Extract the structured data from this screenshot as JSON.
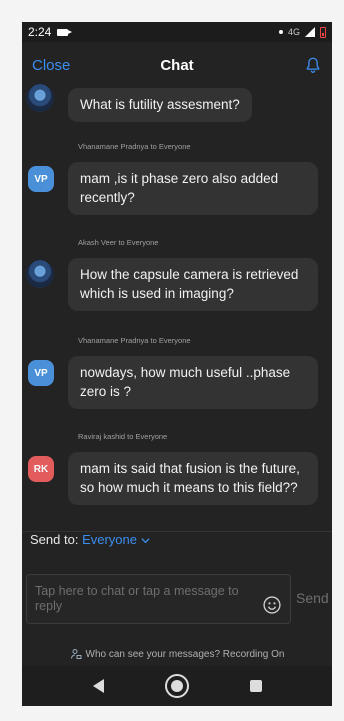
{
  "statusbar": {
    "time": "2:24",
    "network": "4G"
  },
  "header": {
    "close_label": "Close",
    "title": "Chat"
  },
  "messages": [
    {
      "sender": "",
      "avatar": "photo",
      "text": "What is futility assesment?"
    },
    {
      "sender": "Vhanamane Pradnya to Everyone",
      "avatar": "VP",
      "text": "mam ,is it phase zero also added recently?"
    },
    {
      "sender": "Akash Veer to Everyone",
      "avatar": "photo",
      "text": "How the capsule camera is retrieved which is used in imaging?"
    },
    {
      "sender": "Vhanamane Pradnya to Everyone",
      "avatar": "VP",
      "text": "nowdays, how much useful ..phase zero is ?"
    },
    {
      "sender": "Raviraj kashid to Everyone",
      "avatar": "RK",
      "text": "mam its said that fusion is the future, so how much it means to this field??"
    }
  ],
  "composer": {
    "send_to_label": "Send to:",
    "send_to_value": "Everyone",
    "placeholder": "Tap here to chat or tap a message to reply",
    "send_label": "Send"
  },
  "footer": {
    "privacy_text": "Who can see your messages? Recording On"
  },
  "colors": {
    "accent": "#3b8ef0",
    "vp_avatar": "#4a90d9",
    "rk_avatar": "#e25c5c",
    "background": "#232323"
  },
  "icons": [
    "camera-icon",
    "bell-icon",
    "smiley-icon",
    "person-lock-icon",
    "back-nav-icon",
    "home-nav-icon",
    "recents-nav-icon"
  ]
}
